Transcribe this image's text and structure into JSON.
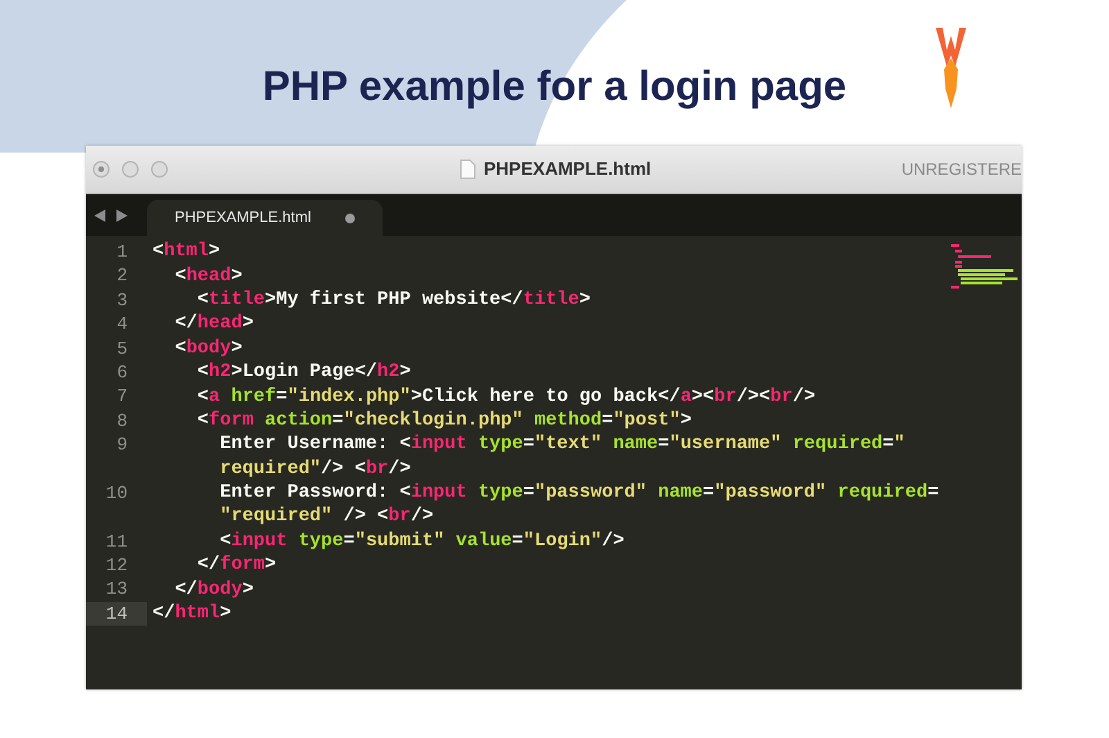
{
  "heading": "PHP example for a login page",
  "window": {
    "title": "PHPEXAMPLE.html",
    "registration": "UNREGISTERE"
  },
  "tabs": [
    {
      "label": "PHPEXAMPLE.html",
      "selected": true,
      "modified": true
    }
  ],
  "editor": {
    "lines": [
      {
        "number": "1",
        "current": false,
        "rows": [
          {
            "tokens": [
              {
                "kind": "punct",
                "text": "<"
              },
              {
                "kind": "tag",
                "text": "html"
              },
              {
                "kind": "punct",
                "text": ">"
              }
            ]
          }
        ]
      },
      {
        "number": "2",
        "current": false,
        "rows": [
          {
            "tokens": [
              {
                "kind": "punct",
                "text": "  <"
              },
              {
                "kind": "tag",
                "text": "head"
              },
              {
                "kind": "punct",
                "text": ">"
              }
            ]
          }
        ]
      },
      {
        "number": "3",
        "current": false,
        "rows": [
          {
            "tokens": [
              {
                "kind": "punct",
                "text": "    <"
              },
              {
                "kind": "tag",
                "text": "title"
              },
              {
                "kind": "punct",
                "text": ">My first PHP website</"
              },
              {
                "kind": "tag",
                "text": "title"
              },
              {
                "kind": "punct",
                "text": ">"
              }
            ]
          }
        ]
      },
      {
        "number": "4",
        "current": false,
        "rows": [
          {
            "tokens": [
              {
                "kind": "punct",
                "text": "  </"
              },
              {
                "kind": "tag",
                "text": "head"
              },
              {
                "kind": "punct",
                "text": ">"
              }
            ]
          }
        ]
      },
      {
        "number": "5",
        "current": false,
        "rows": [
          {
            "tokens": [
              {
                "kind": "punct",
                "text": "  <"
              },
              {
                "kind": "tag",
                "text": "body"
              },
              {
                "kind": "punct",
                "text": ">"
              }
            ]
          }
        ]
      },
      {
        "number": "6",
        "current": false,
        "rows": [
          {
            "tokens": [
              {
                "kind": "punct",
                "text": "    <"
              },
              {
                "kind": "tag",
                "text": "h2"
              },
              {
                "kind": "punct",
                "text": ">Login Page</"
              },
              {
                "kind": "tag",
                "text": "h2"
              },
              {
                "kind": "punct",
                "text": ">"
              }
            ]
          }
        ]
      },
      {
        "number": "7",
        "current": false,
        "rows": [
          {
            "tokens": [
              {
                "kind": "punct",
                "text": "    <"
              },
              {
                "kind": "tag",
                "text": "a"
              },
              {
                "kind": "attr",
                "text": " href"
              },
              {
                "kind": "punct",
                "text": "="
              },
              {
                "kind": "string",
                "text": "\"index.php\""
              },
              {
                "kind": "punct",
                "text": ">Click here to go back</"
              },
              {
                "kind": "tag",
                "text": "a"
              },
              {
                "kind": "punct",
                "text": "><"
              },
              {
                "kind": "tag",
                "text": "br"
              },
              {
                "kind": "punct",
                "text": "/><"
              },
              {
                "kind": "tag",
                "text": "br"
              },
              {
                "kind": "punct",
                "text": "/>"
              }
            ]
          }
        ]
      },
      {
        "number": "8",
        "current": false,
        "rows": [
          {
            "tokens": [
              {
                "kind": "punct",
                "text": "    <"
              },
              {
                "kind": "tag",
                "text": "form"
              },
              {
                "kind": "attr",
                "text": " action"
              },
              {
                "kind": "punct",
                "text": "="
              },
              {
                "kind": "string",
                "text": "\"checklogin.php\""
              },
              {
                "kind": "attr",
                "text": " method"
              },
              {
                "kind": "punct",
                "text": "="
              },
              {
                "kind": "string",
                "text": "\"post\""
              },
              {
                "kind": "punct",
                "text": ">"
              }
            ]
          }
        ]
      },
      {
        "number": "9",
        "current": false,
        "rows": [
          {
            "tokens": [
              {
                "kind": "punct",
                "text": "      Enter Username: <"
              },
              {
                "kind": "tag",
                "text": "input"
              },
              {
                "kind": "attr",
                "text": " type"
              },
              {
                "kind": "punct",
                "text": "="
              },
              {
                "kind": "string",
                "text": "\"text\""
              },
              {
                "kind": "attr",
                "text": " name"
              },
              {
                "kind": "punct",
                "text": "="
              },
              {
                "kind": "string",
                "text": "\"username\""
              },
              {
                "kind": "attr",
                "text": " required"
              },
              {
                "kind": "punct",
                "text": "="
              },
              {
                "kind": "string",
                "text": "\""
              }
            ]
          },
          {
            "tokens": [
              {
                "kind": "string",
                "text": "      required\""
              },
              {
                "kind": "punct",
                "text": "/> <"
              },
              {
                "kind": "tag",
                "text": "br"
              },
              {
                "kind": "punct",
                "text": "/>"
              }
            ]
          }
        ]
      },
      {
        "number": "10",
        "current": false,
        "rows": [
          {
            "tokens": [
              {
                "kind": "punct",
                "text": "      Enter Password: <"
              },
              {
                "kind": "tag",
                "text": "input"
              },
              {
                "kind": "attr",
                "text": " type"
              },
              {
                "kind": "punct",
                "text": "="
              },
              {
                "kind": "string",
                "text": "\"password\""
              },
              {
                "kind": "attr",
                "text": " name"
              },
              {
                "kind": "punct",
                "text": "="
              },
              {
                "kind": "string",
                "text": "\"password\""
              },
              {
                "kind": "attr",
                "text": " required"
              },
              {
                "kind": "punct",
                "text": "="
              }
            ]
          },
          {
            "tokens": [
              {
                "kind": "string",
                "text": "      \"required\""
              },
              {
                "kind": "punct",
                "text": " /> <"
              },
              {
                "kind": "tag",
                "text": "br"
              },
              {
                "kind": "punct",
                "text": "/>"
              }
            ]
          }
        ]
      },
      {
        "number": "11",
        "current": false,
        "rows": [
          {
            "tokens": [
              {
                "kind": "punct",
                "text": "      <"
              },
              {
                "kind": "tag",
                "text": "input"
              },
              {
                "kind": "attr",
                "text": " type"
              },
              {
                "kind": "punct",
                "text": "="
              },
              {
                "kind": "string",
                "text": "\"submit\""
              },
              {
                "kind": "attr",
                "text": " value"
              },
              {
                "kind": "punct",
                "text": "="
              },
              {
                "kind": "string",
                "text": "\"Login\""
              },
              {
                "kind": "punct",
                "text": "/>"
              }
            ]
          }
        ]
      },
      {
        "number": "12",
        "current": false,
        "rows": [
          {
            "tokens": [
              {
                "kind": "punct",
                "text": "    </"
              },
              {
                "kind": "tag",
                "text": "form"
              },
              {
                "kind": "punct",
                "text": ">"
              }
            ]
          }
        ]
      },
      {
        "number": "13",
        "current": false,
        "rows": [
          {
            "tokens": [
              {
                "kind": "punct",
                "text": "  </"
              },
              {
                "kind": "tag",
                "text": "body"
              },
              {
                "kind": "punct",
                "text": ">"
              }
            ]
          }
        ]
      },
      {
        "number": "14",
        "current": true,
        "rows": [
          {
            "tokens": [
              {
                "kind": "punct",
                "text": "</"
              },
              {
                "kind": "tag",
                "text": "html"
              },
              {
                "kind": "punct",
                "text": ">"
              }
            ]
          }
        ]
      }
    ]
  }
}
